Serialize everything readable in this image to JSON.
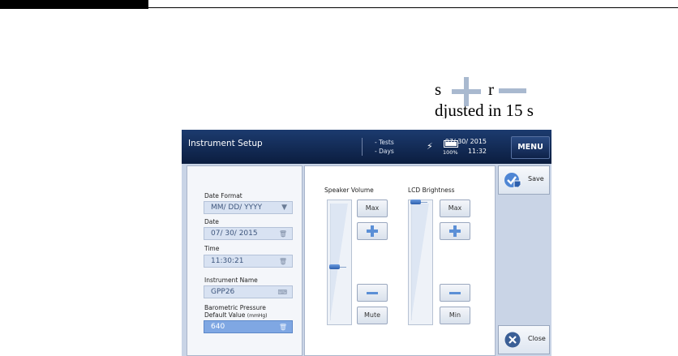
{
  "doc": {
    "line1_left": "s",
    "line1_right": "r",
    "line2": "djusted in 15 s"
  },
  "app": {
    "title": "Instrument Setup",
    "status": {
      "tests": "- Tests",
      "days": "- Days",
      "battery": "100%",
      "date": "07/ 30/ 2015",
      "time": "11:32"
    },
    "menu_label": "MENU"
  },
  "settings": {
    "date_format": {
      "label": "Date Format",
      "value": "MM/ DD/ YYYY"
    },
    "date": {
      "label": "Date",
      "value": "07/ 30/ 2015"
    },
    "time": {
      "label": "Time",
      "value": "11:30:21"
    },
    "instrument_name": {
      "label": "Instrument Name",
      "value": "GPP26"
    },
    "baro": {
      "label_line1": "Barometric Pressure",
      "label_line2": "Default Value",
      "unit": "(mmHg)",
      "value": "640"
    }
  },
  "speaker": {
    "label": "Speaker Volume",
    "max": "Max",
    "mute": "Mute",
    "level": 0.45
  },
  "lcd": {
    "label": "LCD Brightness",
    "max": "Max",
    "min": "Min",
    "level": 1.0
  },
  "actions": {
    "save": "Save",
    "close": "Close"
  },
  "icons": [
    "plus-icon",
    "minus-icon",
    "plug-icon",
    "battery-icon",
    "dropdown-arrow-icon",
    "clear-icon",
    "keyboard-icon",
    "save-icon",
    "close-icon"
  ],
  "colors": {
    "header": "#0b1d3f",
    "panel_bg": "#c9d4e6",
    "accent": "#5b8fd6",
    "selected_field": "#7fa7e3"
  }
}
